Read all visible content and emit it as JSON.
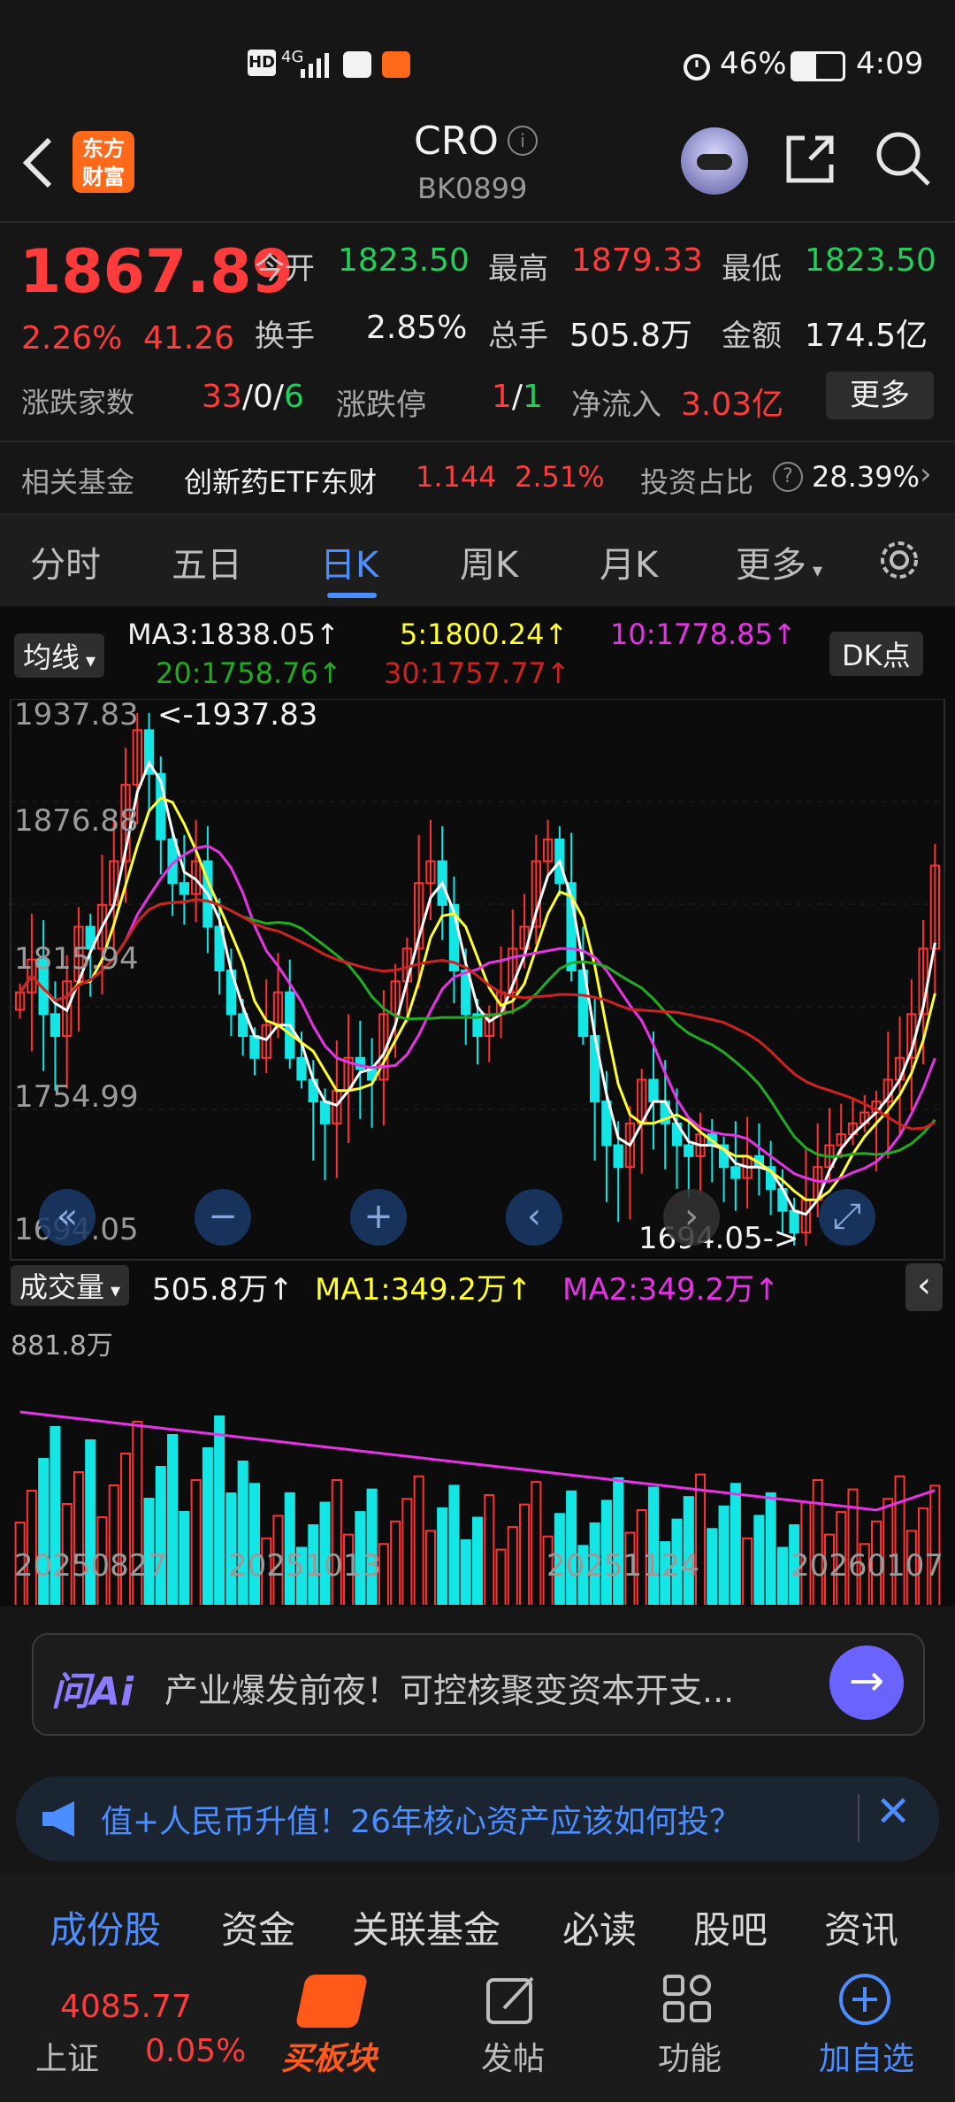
{
  "status_bar": {
    "network": "HD 4G",
    "battery": "46%",
    "time": "4:09"
  },
  "header": {
    "logo_line1": "东方",
    "logo_line2": "财富",
    "title": "CRO",
    "code": "BK0899"
  },
  "quote": {
    "price": "1867.89",
    "change_pct": "2.26%",
    "change": "41.26",
    "open_label": "今开",
    "open": "1823.50",
    "high_label": "最高",
    "high": "1879.33",
    "low_label": "最低",
    "low": "1823.50",
    "turnover_label": "换手",
    "turnover": "2.85%",
    "volume_label": "总手",
    "volume": "505.8万",
    "amount_label": "金额",
    "amount": "174.5亿",
    "advdec_label": "涨跌家数",
    "adv": "33",
    "flat": "0",
    "dec": "6",
    "limit_label": "涨跌停",
    "limit_up": "1",
    "limit_down": "1",
    "netflow_label": "净流入",
    "netflow": "3.03亿",
    "more_label": "更多"
  },
  "fund_row": {
    "label": "相关基金",
    "fund_name": "创新药ETF东财",
    "fund_price": "1.144",
    "fund_pct": "2.51%",
    "ratio_label": "投资占比",
    "ratio": "28.39%"
  },
  "tabs": [
    "分时",
    "五日",
    "日K",
    "周K",
    "月K",
    "更多"
  ],
  "chart": {
    "ma_button": "均线",
    "ma3": "MA3:1838.05↑",
    "ma5": "5:1800.24↑",
    "ma10": "10:1778.85↑",
    "ma20": "20:1758.76↑",
    "ma30": "30:1757.77↑",
    "dk_label": "DK点",
    "y_labels": [
      "1937.83",
      "1876.88",
      "1815.94",
      "1754.99",
      "1694.05"
    ],
    "high_marker": "<-1937.83",
    "low_marker": "1694.05->",
    "vol_button": "成交量",
    "vol_value": "505.8万↑",
    "vol_ma1": "MA1:349.2万↑",
    "vol_ma2": "MA2:349.2万↑",
    "vol_max": "881.8万",
    "dates": [
      "20250827",
      "20251013",
      "20251124",
      "20260107"
    ],
    "colors": {
      "up": "#ff3333",
      "down": "#14e6e6",
      "ma3": "#ffffff",
      "ma5": "#ffff33",
      "ma10": "#e633e6",
      "ma20": "#22aa22",
      "ma30": "#cc2222"
    }
  },
  "chart_data": {
    "type": "candlestick",
    "title": "",
    "ylim": [
      1694.05,
      1937.83
    ],
    "close": [
      1810,
      1825,
      1800,
      1790,
      1815,
      1840,
      1830,
      1850,
      1870,
      1905,
      1930,
      1910,
      1880,
      1860,
      1855,
      1870,
      1840,
      1820,
      1800,
      1790,
      1780,
      1795,
      1810,
      1780,
      1770,
      1760,
      1750,
      1765,
      1780,
      1775,
      1770,
      1800,
      1815,
      1830,
      1860,
      1870,
      1850,
      1820,
      1800,
      1790,
      1800,
      1810,
      1830,
      1840,
      1870,
      1880,
      1860,
      1820,
      1790,
      1760,
      1740,
      1730,
      1750,
      1770,
      1760,
      1750,
      1740,
      1735,
      1745,
      1740,
      1730,
      1725,
      1735,
      1730,
      1720,
      1710,
      1700,
      1715,
      1730,
      1740,
      1745,
      1750,
      1755,
      1760,
      1770,
      1780,
      1800,
      1830,
      1868
    ],
    "volume_unit": "万",
    "volume_max": 881.8,
    "volume_last": 505.8,
    "volume_ma": 349.2
  },
  "ai_bar": {
    "logo": "问Ai",
    "text": "产业爆发前夜！可控核聚变资本开支..."
  },
  "notice": {
    "text": "值+人民币升值！26年核心资产应该如何投？"
  },
  "subtabs": [
    "成份股",
    "资金",
    "关联基金",
    "必读",
    "股吧",
    "资讯"
  ],
  "bottom_bar": {
    "index_value": "4085.77",
    "index_name": "上证",
    "index_pct": "0.05%",
    "buy_label": "买板块",
    "post_label": "发帖",
    "func_label": "功能",
    "add_label": "加自选"
  }
}
